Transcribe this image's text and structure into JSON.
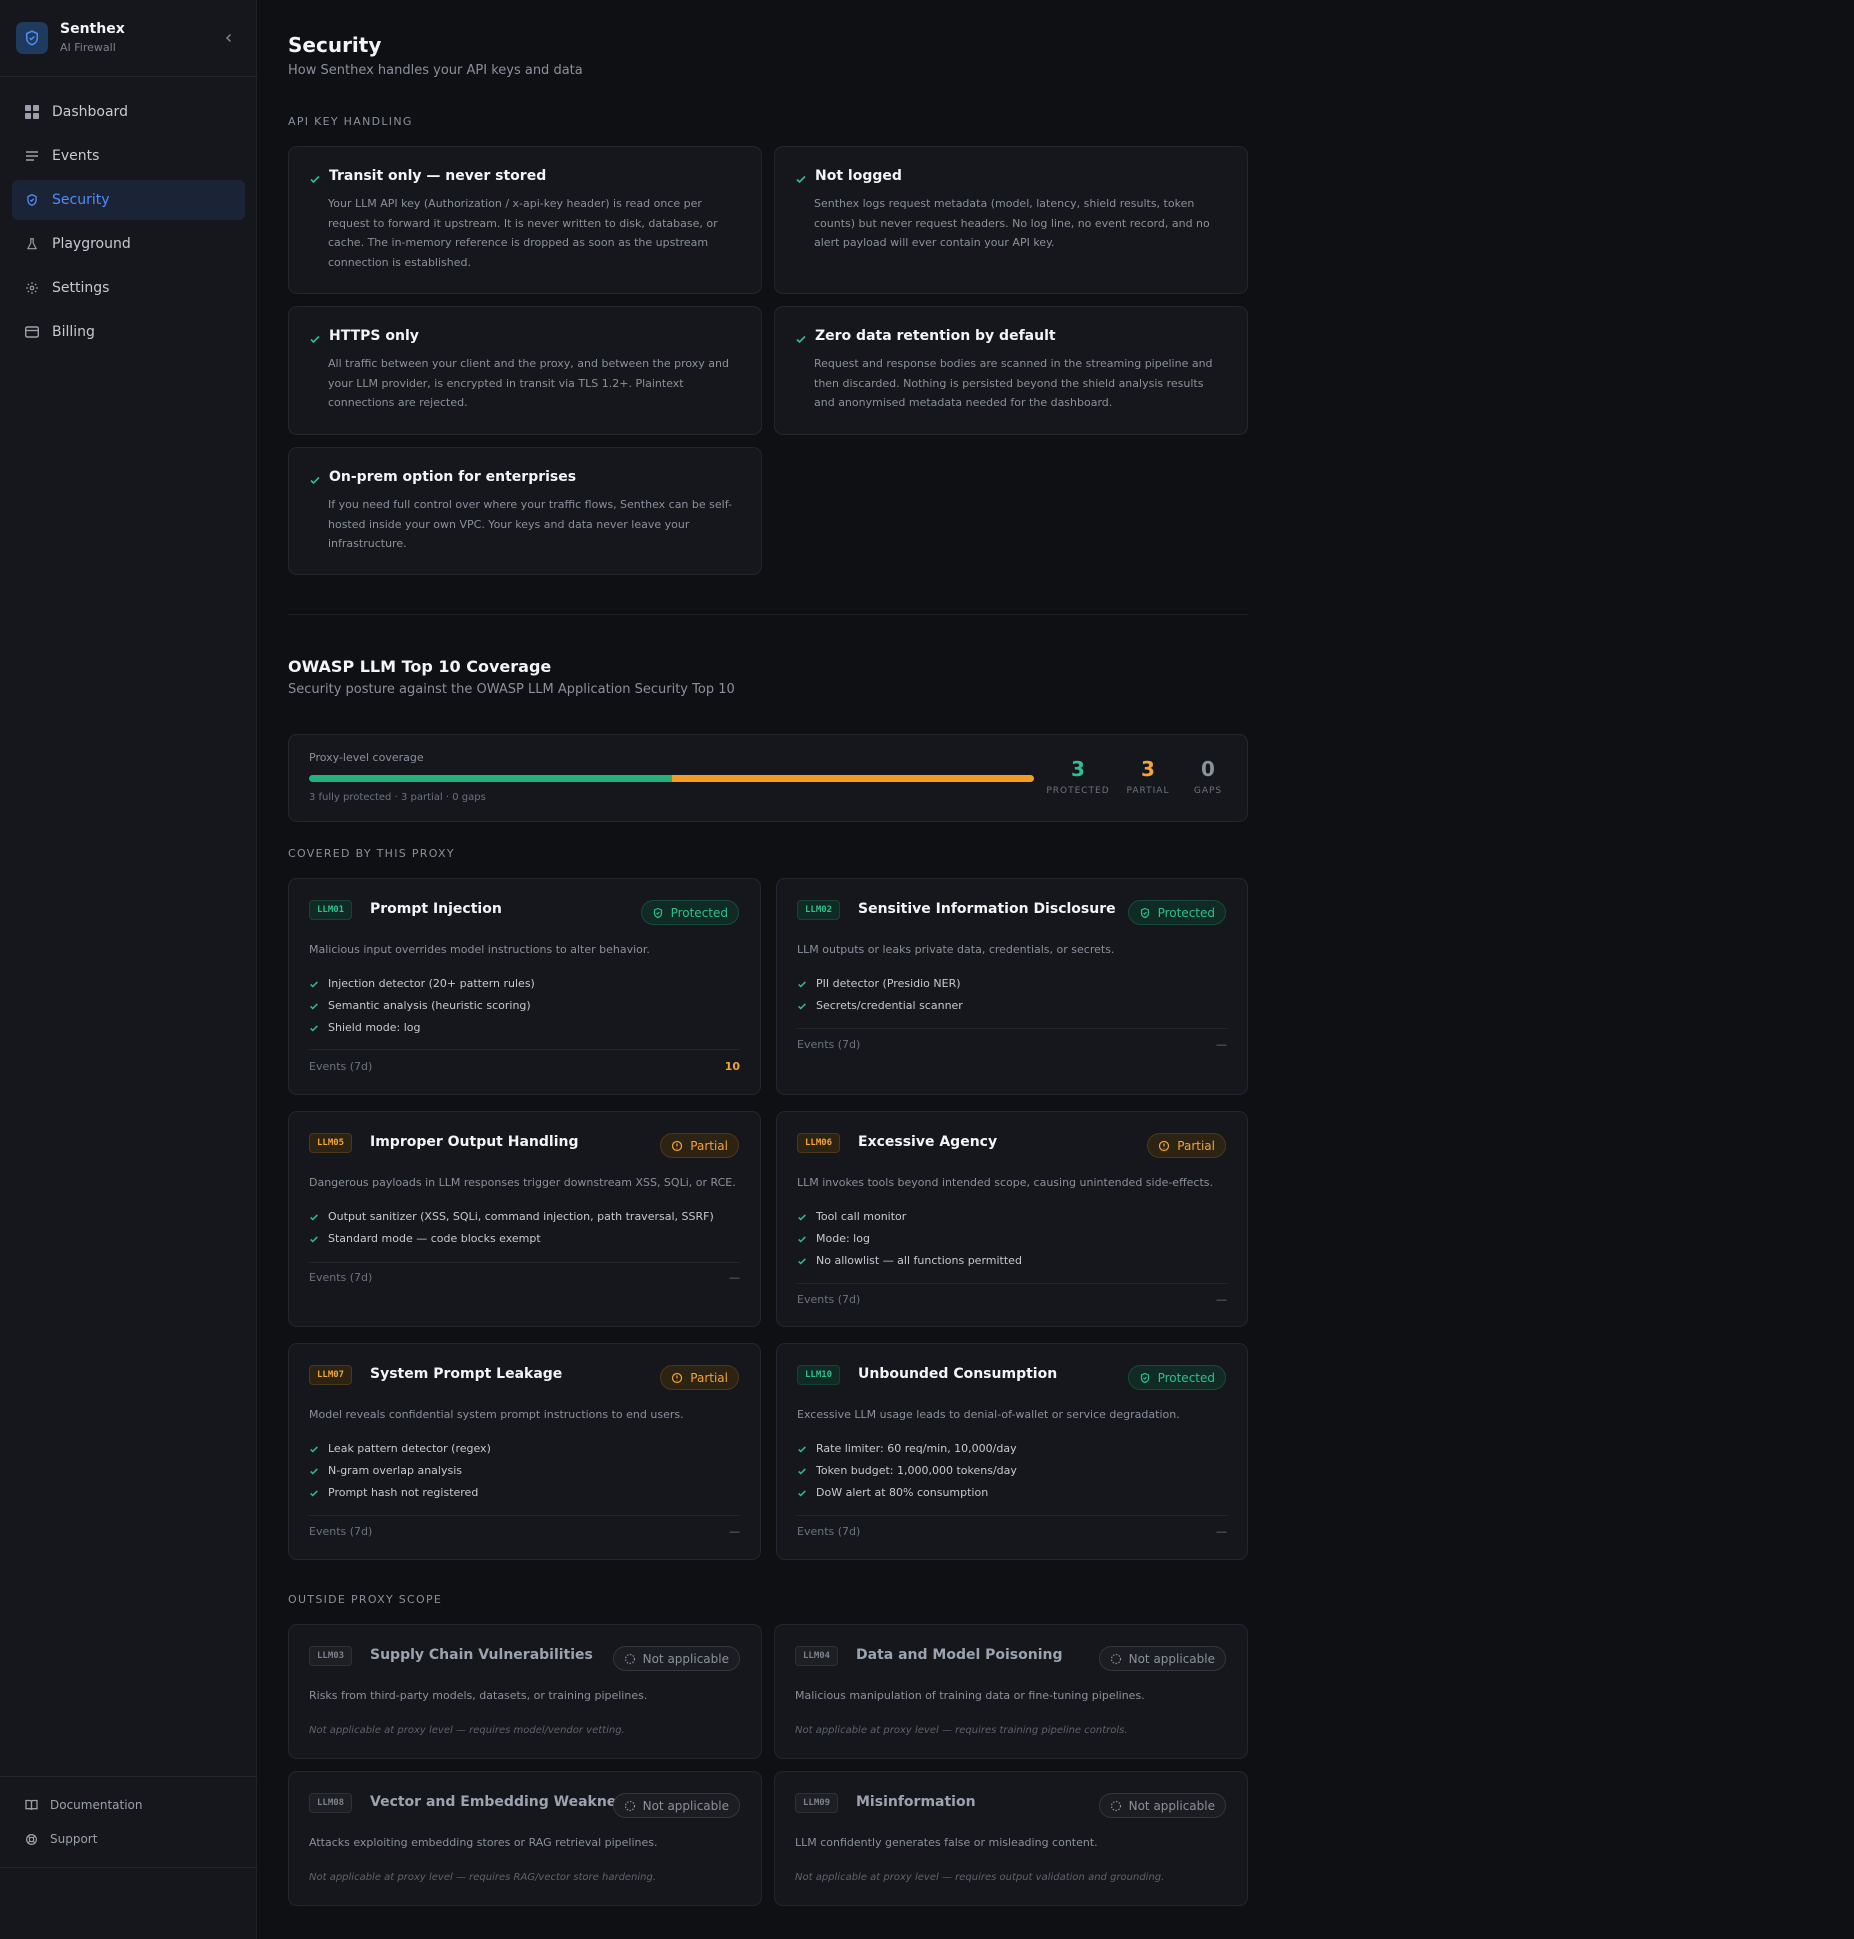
{
  "brand": {
    "name": "Senthex",
    "subtitle": "AI Firewall"
  },
  "nav": [
    {
      "label": "Dashboard",
      "icon": "grid-icon"
    },
    {
      "label": "Events",
      "icon": "list-icon"
    },
    {
      "label": "Security",
      "icon": "shield-icon",
      "active": true
    },
    {
      "label": "Playground",
      "icon": "flask-icon"
    },
    {
      "label": "Settings",
      "icon": "gear-icon"
    },
    {
      "label": "Billing",
      "icon": "card-icon"
    }
  ],
  "footer_nav": [
    {
      "label": "Documentation",
      "icon": "book-icon"
    },
    {
      "label": "Support",
      "icon": "lifebuoy-icon"
    }
  ],
  "page": {
    "title": "Security",
    "subtitle": "How Senthex handles your API keys and data"
  },
  "api_key_handling": {
    "label": "API KEY HANDLING",
    "items": [
      {
        "title": "Transit only — never stored",
        "desc": "Your LLM API key (Authorization / x-api-key header) is read once per request to forward it upstream. It is never written to disk, database, or cache. The in-memory reference is dropped as soon as the upstream connection is established."
      },
      {
        "title": "Not logged",
        "desc": "Senthex logs request metadata (model, latency, shield results, token counts) but never request headers. No log line, no event record, and no alert payload will ever contain your API key."
      },
      {
        "title": "HTTPS only",
        "desc": "All traffic between your client and the proxy, and between the proxy and your LLM provider, is encrypted in transit via TLS 1.2+. Plaintext connections are rejected."
      },
      {
        "title": "Zero data retention by default",
        "desc": "Request and response bodies are scanned in the streaming pipeline and then discarded. Nothing is persisted beyond the shield analysis results and anonymised metadata needed for the dashboard."
      },
      {
        "title": "On-prem option for enterprises",
        "desc": "If you need full control over where your traffic flows, Senthex can be self-hosted inside your own VPC. Your keys and data never leave your infrastructure."
      }
    ]
  },
  "owasp": {
    "title": "OWASP LLM Top 10 Coverage",
    "subtitle": "Security posture against the OWASP LLM Application Security Top 10",
    "coverage": {
      "label": "Proxy-level coverage",
      "summary": "3 fully protected · 3 partial · 0 gaps",
      "protected_fraction": 0.5,
      "partial_fraction": 0.5,
      "stats": [
        {
          "value": "3",
          "label": "PROTECTED",
          "color": "#2fbf8f"
        },
        {
          "value": "3",
          "label": "PARTIAL",
          "color": "#f0a43a"
        },
        {
          "value": "0",
          "label": "GAPS",
          "color": "#8a909c"
        }
      ]
    },
    "covered_label": "COVERED BY THIS PROXY",
    "covered": [
      {
        "code": "LLM01",
        "title": "Prompt Injection",
        "status": "Protected",
        "tone": "green",
        "desc": "Malicious input overrides model instructions to alter behavior.",
        "features": [
          "Injection detector (20+ pattern rules)",
          "Semantic analysis (heuristic scoring)",
          "Shield mode: log"
        ],
        "events_label": "Events (7d)",
        "events_value": "10"
      },
      {
        "code": "LLM02",
        "title": "Sensitive Information Disclosure",
        "status": "Protected",
        "tone": "green",
        "desc": "LLM outputs or leaks private data, credentials, or secrets.",
        "features": [
          "PII detector (Presidio NER)",
          "Secrets/credential scanner"
        ],
        "events_label": "Events (7d)",
        "events_value": "—"
      },
      {
        "code": "LLM05",
        "title": "Improper Output Handling",
        "status": "Partial",
        "tone": "amber",
        "desc": "Dangerous payloads in LLM responses trigger downstream XSS, SQLi, or RCE.",
        "features": [
          "Output sanitizer (XSS, SQLi, command injection, path traversal, SSRF)",
          "Standard mode — code blocks exempt"
        ],
        "events_label": "Events (7d)",
        "events_value": "—"
      },
      {
        "code": "LLM06",
        "title": "Excessive Agency",
        "status": "Partial",
        "tone": "amber",
        "desc": "LLM invokes tools beyond intended scope, causing unintended side-effects.",
        "features": [
          "Tool call monitor",
          "Mode: log",
          "No allowlist — all functions permitted"
        ],
        "events_label": "Events (7d)",
        "events_value": "—"
      },
      {
        "code": "LLM07",
        "title": "System Prompt Leakage",
        "status": "Partial",
        "tone": "amber",
        "desc": "Model reveals confidential system prompt instructions to end users.",
        "features": [
          "Leak pattern detector (regex)",
          "N-gram overlap analysis",
          "Prompt hash not registered"
        ],
        "events_label": "Events (7d)",
        "events_value": "—"
      },
      {
        "code": "LLM10",
        "title": "Unbounded Consumption",
        "status": "Protected",
        "tone": "green",
        "desc": "Excessive LLM usage leads to denial-of-wallet or service degradation.",
        "features": [
          "Rate limiter: 60 req/min, 10,000/day",
          "Token budget: 1,000,000 tokens/day",
          "DoW alert at 80% consumption"
        ],
        "events_label": "Events (7d)",
        "events_value": "—"
      }
    ],
    "outside_label": "OUTSIDE PROXY SCOPE",
    "outside": [
      {
        "code": "LLM03",
        "title": "Supply Chain Vulnerabilities",
        "status": "Not applicable",
        "desc": "Risks from third-party models, datasets, or training pipelines.",
        "note": "Not applicable at proxy level — requires model/vendor vetting."
      },
      {
        "code": "LLM04",
        "title": "Data and Model Poisoning",
        "status": "Not applicable",
        "desc": "Malicious manipulation of training data or fine-tuning pipelines.",
        "note": "Not applicable at proxy level — requires training pipeline controls."
      },
      {
        "code": "LLM08",
        "title": "Vector and Embedding Weaknesses",
        "status": "Not applicable",
        "desc": "Attacks exploiting embedding stores or RAG retrieval pipelines.",
        "note": "Not applicable at proxy level — requires RAG/vector store hardening."
      },
      {
        "code": "LLM09",
        "title": "Misinformation",
        "status": "Not applicable",
        "desc": "LLM confidently generates false or misleading content.",
        "note": "Not applicable at proxy level — requires output validation and grounding."
      }
    ]
  },
  "colors": {
    "accent": "#4f8df7",
    "protected": "#2fbf8f",
    "partial": "#f0a43a"
  }
}
